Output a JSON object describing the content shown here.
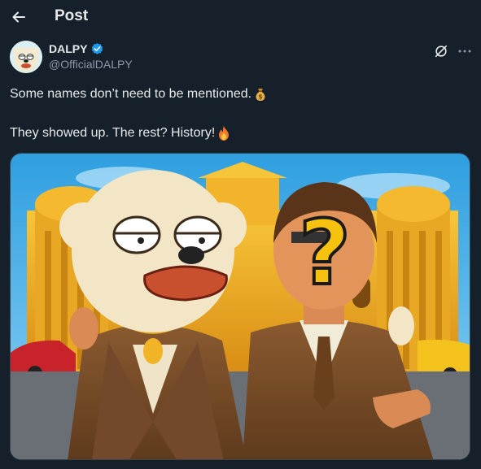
{
  "header": {
    "title": "Post"
  },
  "author": {
    "display_name": "DALPY",
    "handle": "@OfficialDALPY",
    "verified": true
  },
  "tweet": {
    "line1": "Some names don’t need to be mentioned.",
    "line1_emoji": "money-bag-icon",
    "line2": "They showed up. The rest? History!",
    "line2_emoji": "fire-icon"
  },
  "icons": {
    "back": "back-arrow-icon",
    "verified": "verified-badge-icon",
    "grok": "grok-icon",
    "more": "more-icon"
  },
  "colors": {
    "background": "#15202b",
    "text": "#e7e9ea",
    "secondary_text": "#8b98a5",
    "verified_blue": "#1d9bf0"
  }
}
